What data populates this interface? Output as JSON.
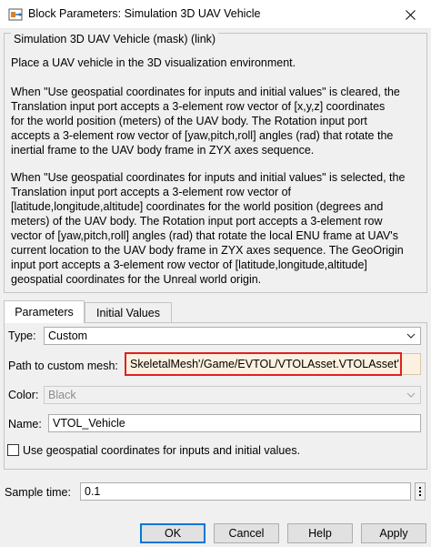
{
  "window": {
    "title": "Block Parameters: Simulation 3D UAV Vehicle",
    "close_icon": "close-icon"
  },
  "mask": {
    "title": "Simulation 3D UAV Vehicle (mask) (link)",
    "paragraphs": [
      [
        "Place a UAV vehicle in the 3D visualization environment."
      ],
      [
        "When \"Use geospatial coordinates for inputs and initial values\" is cleared, the",
        "Translation input port accepts a 3-element row vector of [x,y,z] coordinates",
        "for the world position (meters) of the UAV body. The Rotation input port",
        "accepts a 3-element row vector of [yaw,pitch,roll] angles (rad) that rotate the",
        "inertial frame to the UAV body frame in ZYX axes sequence."
      ],
      [
        "When \"Use geospatial coordinates for inputs and initial values\" is selected, the",
        "Translation input port accepts a 3-element row vector of",
        "[latitude,longitude,altitude] coordinates for the world position (degrees and",
        "meters) of the UAV body. The Rotation input port accepts a 3-element row",
        "vector of [yaw,pitch,roll] angles (rad) that rotate the local ENU frame at UAV's",
        "current location to the UAV body frame in ZYX axes sequence. The GeoOrigin",
        "input port accepts a 3-element row vector of [latitude,longitude,altitude]",
        "geospatial coordinates for the Unreal world origin."
      ]
    ]
  },
  "tabs": [
    {
      "label": "Parameters",
      "active": true
    },
    {
      "label": "Initial Values",
      "active": false
    }
  ],
  "params": {
    "type_label": "Type:",
    "type_value": "Custom",
    "mesh_label": "Path to custom mesh:",
    "mesh_value": "SkeletalMesh'/Game/EVTOL/VTOLAsset.VTOLAsset'",
    "color_label": "Color:",
    "color_value": "Black",
    "name_label": "Name:",
    "name_value": "VTOL_Vehicle",
    "geo_checkbox_label": "Use geospatial coordinates for inputs and initial values."
  },
  "sample_time": {
    "label": "Sample time:",
    "value": "0.1"
  },
  "buttons": {
    "ok": "OK",
    "cancel": "Cancel",
    "help": "Help",
    "apply": "Apply"
  },
  "colors": {
    "highlight": "#e02020",
    "mesh_field_bg": "#fcf0e0",
    "default_button_border": "#0078d7"
  }
}
